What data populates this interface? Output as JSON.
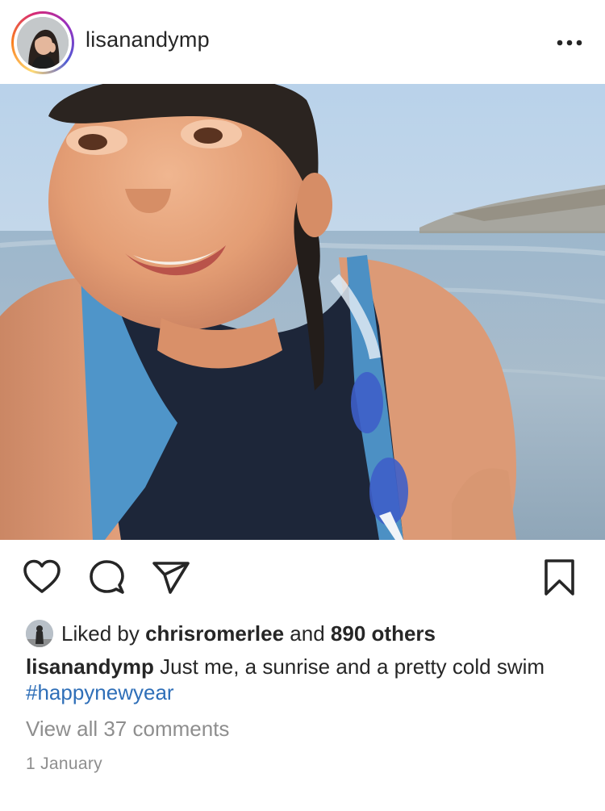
{
  "post": {
    "author": "lisanandymp",
    "liked_prefix": "Liked by",
    "liked_by_user": "chrisromerlee",
    "liked_and": "and",
    "liked_others": "890 others",
    "caption_user": "lisanandymp",
    "caption_text": "Just me, a sunrise and a pretty cold swim",
    "caption_hashtag": "#happynewyear",
    "view_comments": "View all 37 comments",
    "date": "1 January"
  },
  "icons": {
    "more": "more-options-icon",
    "like": "heart-icon",
    "comment": "comment-icon",
    "share": "share-icon",
    "save": "bookmark-icon"
  },
  "colors": {
    "text": "#262626",
    "muted": "#8e8e8e",
    "hashtag": "#2f6fb8"
  }
}
